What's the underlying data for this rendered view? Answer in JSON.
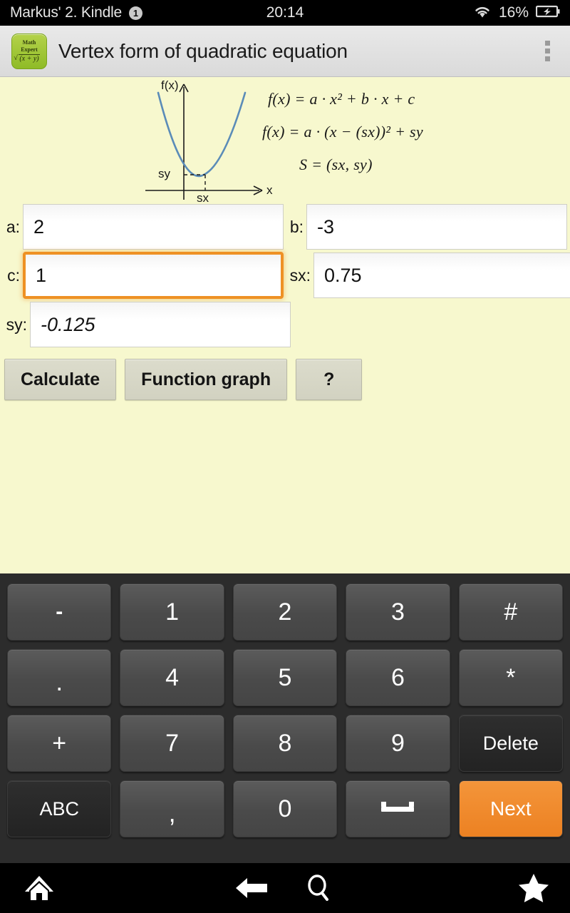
{
  "status_bar": {
    "device_name": "Markus' 2. Kindle",
    "notification_count": "1",
    "clock": "20:14",
    "battery_percent": "16%",
    "wifi_icon": "wifi-icon",
    "battery_icon": "battery-charging-icon"
  },
  "toolbar": {
    "app_icon_line1": "Math",
    "app_icon_line2": "Expert",
    "app_icon_formula": "(x + y)",
    "title": "Vertex form of quadratic equation",
    "overflow_icon": "overflow-menu-icon"
  },
  "diagram": {
    "y_axis_label": "f(x)",
    "x_axis_label": "x",
    "vertex_x_label": "sx",
    "vertex_y_label": "sy",
    "curve_color": "#5B8CB8"
  },
  "equations": {
    "general_form": "f(x) = a · x² + b · x + c",
    "vertex_form": "f(x) = a · (x − (sx))² + sy",
    "vertex_point": "S = (sx, sy)"
  },
  "fields": {
    "a": {
      "label": "a:",
      "value": "2",
      "focused": false,
      "hint": false
    },
    "b": {
      "label": "b:",
      "value": "-3",
      "focused": false,
      "hint": false
    },
    "c": {
      "label": "c:",
      "value": "1",
      "focused": true,
      "hint": false
    },
    "sx": {
      "label": "sx:",
      "value": "0.75",
      "focused": false,
      "hint": false
    },
    "sy": {
      "label": "sy:",
      "value": "-0.125",
      "focused": false,
      "hint": true
    }
  },
  "actions": {
    "calculate": "Calculate",
    "function_graph": "Function graph",
    "help": "?"
  },
  "keyboard": {
    "rows": [
      [
        {
          "label": "-",
          "type": "normal",
          "name": "key-minus"
        },
        {
          "label": "1",
          "type": "normal",
          "name": "key-1"
        },
        {
          "label": "2",
          "type": "normal",
          "name": "key-2"
        },
        {
          "label": "3",
          "type": "normal",
          "name": "key-3"
        },
        {
          "label": "#",
          "type": "normal",
          "name": "key-hash"
        }
      ],
      [
        {
          "label": ".",
          "type": "normal",
          "name": "key-period"
        },
        {
          "label": "4",
          "type": "normal",
          "name": "key-4"
        },
        {
          "label": "5",
          "type": "normal",
          "name": "key-5"
        },
        {
          "label": "6",
          "type": "normal",
          "name": "key-6"
        },
        {
          "label": "*",
          "type": "normal",
          "name": "key-asterisk"
        }
      ],
      [
        {
          "label": "+",
          "type": "normal",
          "name": "key-plus"
        },
        {
          "label": "7",
          "type": "normal",
          "name": "key-7"
        },
        {
          "label": "8",
          "type": "normal",
          "name": "key-8"
        },
        {
          "label": "9",
          "type": "normal",
          "name": "key-9"
        },
        {
          "label": "Delete",
          "type": "fn",
          "name": "key-delete"
        }
      ],
      [
        {
          "label": "ABC",
          "type": "fn",
          "name": "key-abc"
        },
        {
          "label": ",",
          "type": "normal",
          "name": "key-comma"
        },
        {
          "label": "0",
          "type": "normal",
          "name": "key-0"
        },
        {
          "label": "",
          "type": "space",
          "name": "key-space"
        },
        {
          "label": "Next",
          "type": "accent",
          "name": "key-next"
        }
      ]
    ],
    "accent_color": "#EE8A22"
  },
  "navbar": {
    "home_icon": "home-icon",
    "back_icon": "back-arrow-icon",
    "search_icon": "search-icon",
    "star_icon": "star-icon"
  }
}
